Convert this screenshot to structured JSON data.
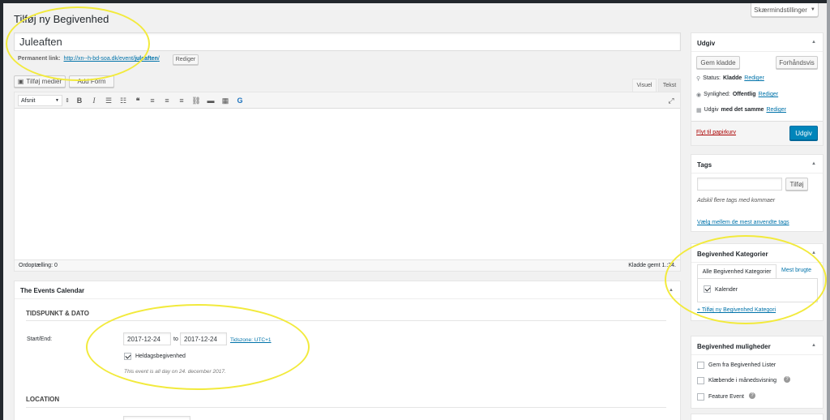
{
  "page": {
    "title": "Tilføj ny Begivenhed",
    "screen_options": "Skærmindstillinger",
    "post_title": "Juleaften",
    "permalink_label": "Permanent link:",
    "permalink_url_pre": "http://xn--h-bd-soa.dk/event/",
    "permalink_slug": "juleaften",
    "permalink_url_post": "/",
    "permalink_edit": "Rediger"
  },
  "editor": {
    "add_media": "Tilføj medier",
    "add_form": "Add Form",
    "tab_visual": "Visuel",
    "tab_text": "Tekst",
    "format_select": "Afsnit",
    "word_count": "Ordoptælling: 0",
    "draft_saved": "Kladde gemt 1.",
    "draft_saved_tail": ":24."
  },
  "events": {
    "title": "The Events Calendar",
    "section_time": "TIDSPUNKT & DATO",
    "start_end_label": "Start/End:",
    "start_date": "2017-12-24",
    "to": "to",
    "end_date": "2017-12-24",
    "timezone": "Tidszone: UTC+1",
    "allday_label": "Heldagsbegivenhed",
    "allday_note": "This event is all day on 24. december 2017.",
    "section_location": "LOCATION"
  },
  "publish": {
    "title": "Udgiv",
    "save_draft": "Gem kladde",
    "preview": "Forhåndsvis",
    "status_label": "Status:",
    "status_value": "Kladde",
    "visibility_label": "Synlighed:",
    "visibility_value": "Offentlig",
    "schedule_pre": "Udgiv",
    "schedule_value": "med det samme",
    "edit": "Rediger",
    "trash": "Flyt til papirkurv",
    "publish_button": "Udgiv"
  },
  "tags": {
    "title": "Tags",
    "add_button": "Tilføj",
    "hint": "Adskil flere tags med kommaer",
    "choose_link": "Vælg mellem de mest anvendte tags"
  },
  "categories": {
    "title": "Begivenhed Kategorier",
    "tab_all": "Alle Begivenhed Kategorier",
    "tab_popular": "Mest brugte",
    "item": "Kalender",
    "add_link": "+ Tilføj ny Begivenhed Kategori"
  },
  "options": {
    "title": "Begivenhed muligheder",
    "opt1": "Gem fra Begivenhed Lister",
    "opt2": "Klæbende i månedsvisning",
    "opt3": "Feature Event"
  }
}
